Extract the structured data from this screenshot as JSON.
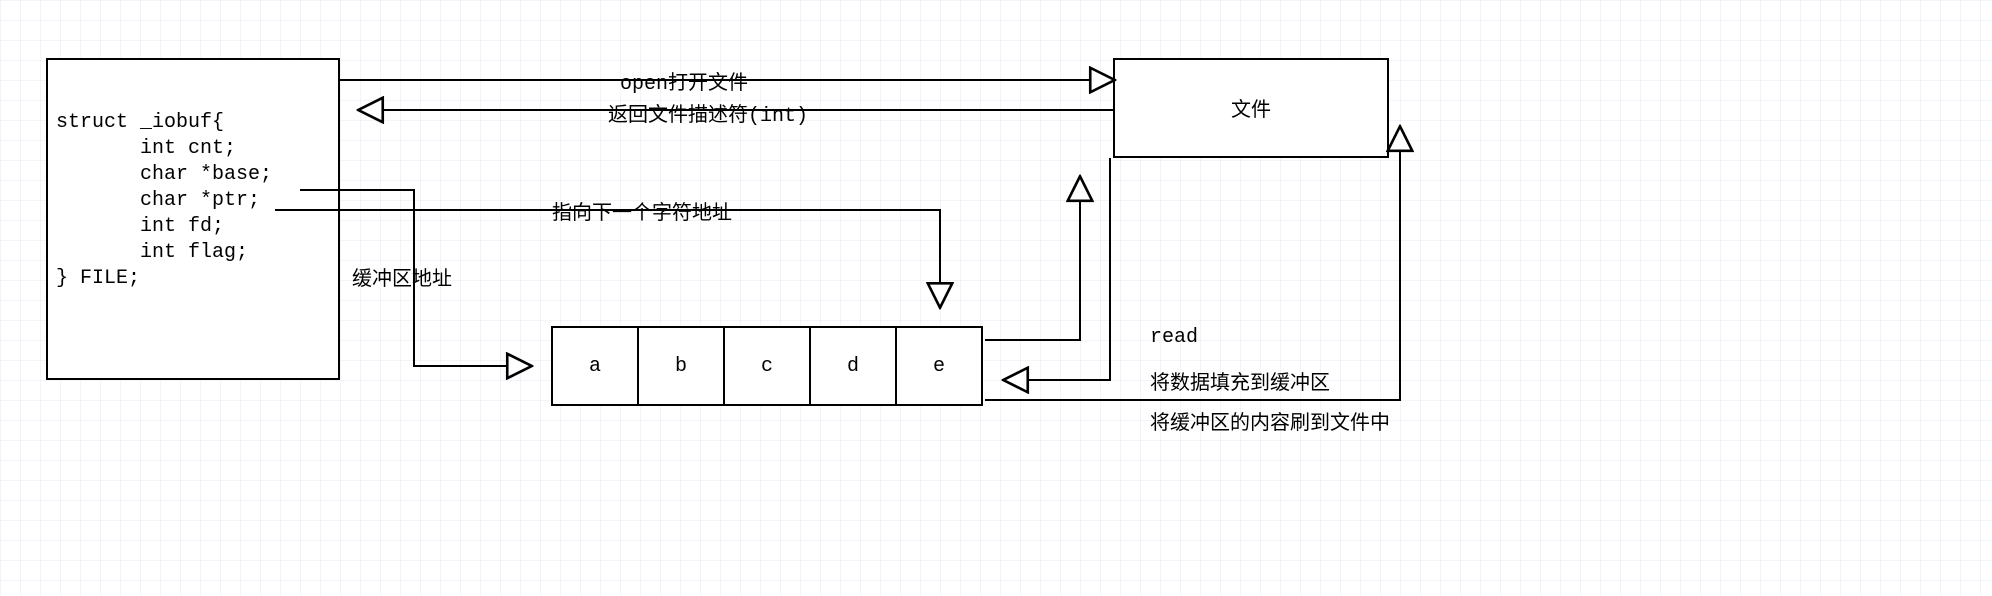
{
  "struct": {
    "l1": "struct _iobuf{",
    "l2": "       int cnt;",
    "l3": "       char *base;",
    "l4": "       char *ptr;",
    "l5": "       int fd;",
    "l6": "       int flag;",
    "l7": "} FILE;"
  },
  "file_box_label": "文件",
  "buffer": {
    "c0": "a",
    "c1": "b",
    "c2": "c",
    "c3": "d",
    "c4": "e"
  },
  "edges": {
    "open": "open打开文件",
    "return_fd": "返回文件描述符(int)",
    "base_label": "缓冲区地址",
    "ptr_label": "指向下一个字符地址",
    "read": "read",
    "fill": "将数据填充到缓冲区",
    "flush": "将缓冲区的内容刷到文件中"
  }
}
